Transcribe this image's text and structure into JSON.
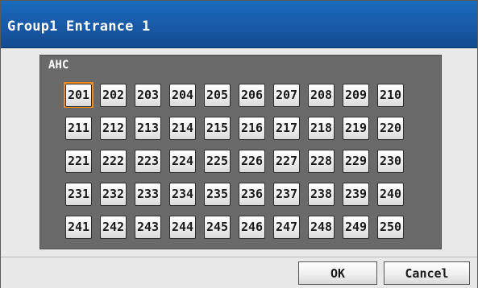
{
  "window": {
    "title": "Group1 Entrance 1"
  },
  "panel": {
    "label": "AHC",
    "selected": "201",
    "units": [
      "201",
      "202",
      "203",
      "204",
      "205",
      "206",
      "207",
      "208",
      "209",
      "210",
      "211",
      "212",
      "213",
      "214",
      "215",
      "216",
      "217",
      "218",
      "219",
      "220",
      "221",
      "222",
      "223",
      "224",
      "225",
      "226",
      "227",
      "228",
      "229",
      "230",
      "231",
      "232",
      "233",
      "234",
      "235",
      "236",
      "237",
      "238",
      "239",
      "240",
      "241",
      "242",
      "243",
      "244",
      "245",
      "246",
      "247",
      "248",
      "249",
      "250"
    ]
  },
  "footer": {
    "ok_label": "OK",
    "cancel_label": "Cancel"
  },
  "colors": {
    "title_bar": "#1859a6",
    "panel": "#6a6a6a",
    "selection": "#f08a1c"
  }
}
